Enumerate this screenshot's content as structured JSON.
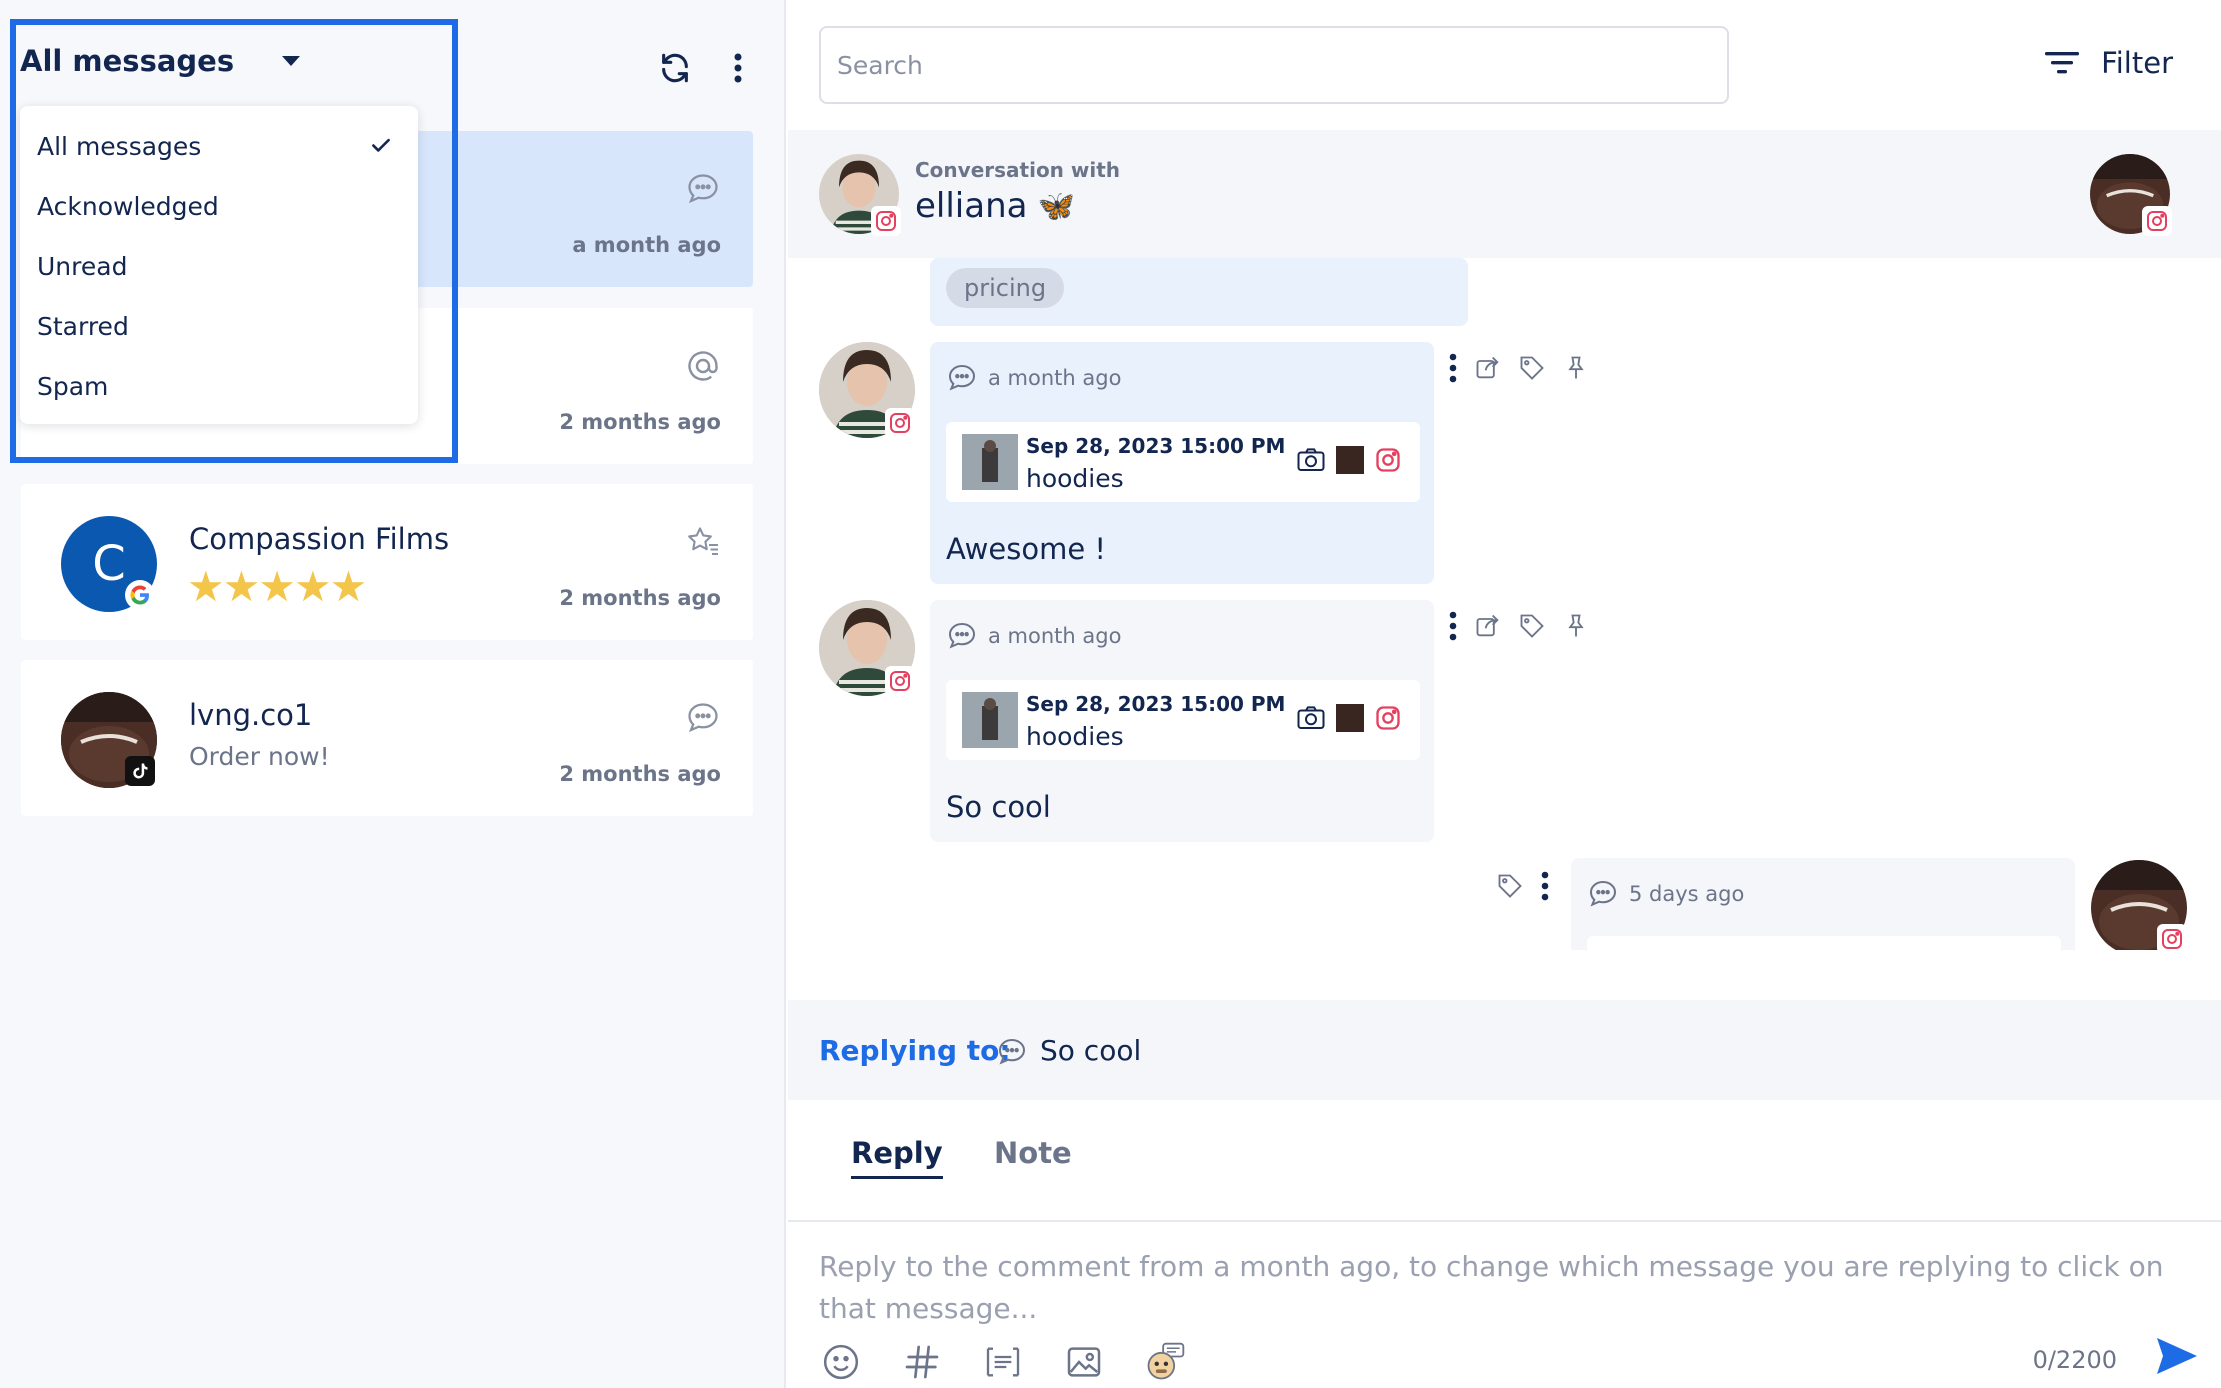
{
  "filter": {
    "selected": "All messages",
    "options": [
      "All messages",
      "Acknowledged",
      "Unread",
      "Starred",
      "Spam"
    ]
  },
  "conversations": [
    {
      "name": "",
      "sub": "",
      "time": "a month ago",
      "type_icon": "comment-icon",
      "platform": "instagram"
    },
    {
      "name": "",
      "sub": "",
      "time": "2 months ago",
      "type_icon": "mention-icon",
      "platform": "instagram"
    },
    {
      "name": "Compassion Films",
      "avatar_letter": "C",
      "rating": 5,
      "time": "2 months ago",
      "type_icon": "review-icon",
      "platform": "google"
    },
    {
      "name": "lvng.co1",
      "sub": "Order now!",
      "time": "2 months ago",
      "type_icon": "comment-icon",
      "platform": "tiktok"
    }
  ],
  "search": {
    "placeholder": "Search"
  },
  "filter_button": {
    "label": "Filter"
  },
  "conversation": {
    "with_label": "Conversation with",
    "name": "elliana",
    "emoji": "🦋"
  },
  "messages": [
    {
      "tag": "pricing"
    },
    {
      "time": "a month ago",
      "post_date": "Sep 28, 2023 15:00 PM",
      "post_title": "hoodies",
      "text": "Awesome !"
    },
    {
      "time": "a month ago",
      "post_date": "Sep 28, 2023 15:00 PM",
      "post_title": "hoodies",
      "text": "So cool"
    },
    {
      "time": "5 days ago"
    }
  ],
  "replying": {
    "label": "Replying to:",
    "text": "So cool"
  },
  "tabs": {
    "reply": "Reply",
    "note": "Note"
  },
  "composer": {
    "placeholder": "Reply to the comment from a month ago, to change which message you are replying to click on that message...",
    "counter": "0/2200"
  },
  "colors": {
    "accent": "#1e6be6",
    "navy": "#12264f",
    "active_card": "#d8e6fc",
    "instagram": "#e4405f",
    "star": "#f3c54b"
  }
}
